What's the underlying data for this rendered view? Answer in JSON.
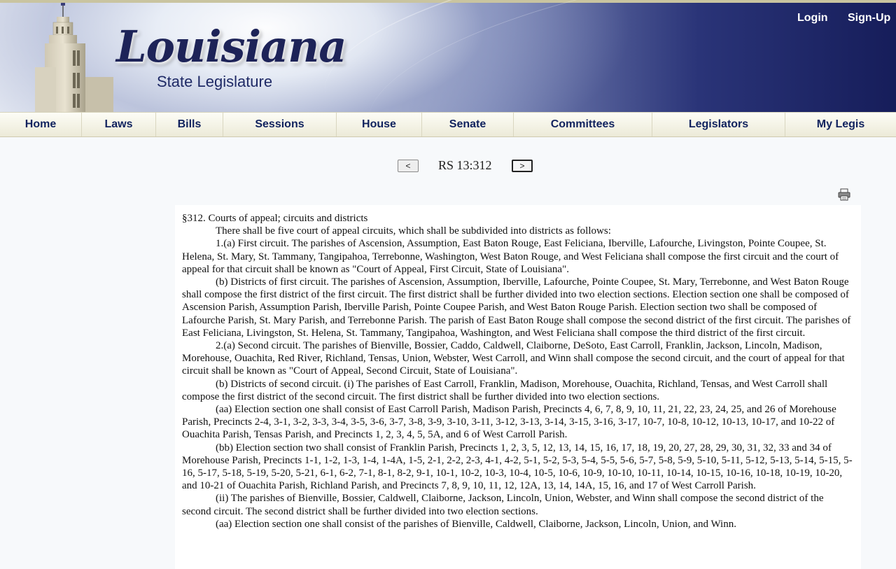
{
  "header": {
    "logo_title": "Louisiana",
    "logo_subtitle": "State Legislature",
    "login_label": "Login",
    "signup_label": "Sign-Up"
  },
  "nav": {
    "items": [
      {
        "label": "Home"
      },
      {
        "label": "Laws"
      },
      {
        "label": "Bills"
      },
      {
        "label": "Sessions"
      },
      {
        "label": "House"
      },
      {
        "label": "Senate"
      },
      {
        "label": "Committees"
      },
      {
        "label": "Legislators"
      },
      {
        "label": "My Legis"
      }
    ]
  },
  "pager": {
    "prev_label": "<",
    "next_label": ">",
    "title": "RS 13:312"
  },
  "document": {
    "heading": "§312. Courts of appeal; circuits and districts",
    "paragraphs": [
      "There shall be five court of appeal circuits, which shall be subdivided into districts as follows:",
      "1.(a) First circuit. The parishes of Ascension, Assumption, East Baton Rouge, East Feliciana, Iberville, Lafourche, Livingston, Pointe Coupee, St. Helena, St. Mary, St. Tammany, Tangipahoa, Terrebonne, Washington, West Baton Rouge, and West Feliciana shall compose the first circuit and the court of appeal for that circuit shall be known as \"Court of Appeal, First Circuit, State of Louisiana\".",
      "(b) Districts of first circuit. The parishes of Ascension, Assumption, Iberville, Lafourche, Pointe Coupee, St. Mary, Terrebonne, and West Baton Rouge shall compose the first district of the first circuit. The first district shall be further divided into two election sections. Election section one shall be composed of Ascension Parish, Assumption Parish, Iberville Parish, Pointe Coupee Parish, and West Baton Rouge Parish. Election section two shall be composed of Lafourche Parish, St. Mary Parish, and Terrebonne Parish. The parish of East Baton Rouge shall compose the second district of the first circuit. The parishes of East Feliciana, Livingston, St. Helena, St. Tammany, Tangipahoa, Washington, and West Feliciana shall compose the third district of the first circuit.",
      "2.(a) Second circuit. The parishes of Bienville, Bossier, Caddo, Caldwell, Claiborne, DeSoto, East Carroll, Franklin, Jackson, Lincoln, Madison, Morehouse, Ouachita, Red River, Richland, Tensas, Union, Webster, West Carroll, and Winn shall compose the second circuit, and the court of appeal for that circuit shall be known as \"Court of Appeal, Second Circuit, State of Louisiana\".",
      "(b) Districts of second circuit. (i) The parishes of East Carroll, Franklin, Madison, Morehouse, Ouachita, Richland, Tensas, and West Carroll shall compose the first district of the second circuit. The first district shall be further divided into two election sections.",
      "(aa) Election section one shall consist of East Carroll Parish, Madison Parish, Precincts 4, 6, 7, 8, 9, 10, 11, 21, 22, 23, 24, 25, and 26 of Morehouse Parish, Precincts 2-4, 3-1, 3-2, 3-3, 3-4, 3-5, 3-6, 3-7, 3-8, 3-9, 3-10, 3-11, 3-12, 3-13, 3-14, 3-15, 3-16, 3-17, 10-7, 10-8, 10-12, 10-13, 10-17, and 10-22 of Ouachita Parish, Tensas Parish, and Precincts 1, 2, 3, 4, 5, 5A, and 6 of West Carroll Parish.",
      "(bb) Election section two shall consist of Franklin Parish, Precincts 1, 2, 3, 5, 12, 13, 14, 15, 16, 17, 18, 19, 20, 27, 28, 29, 30, 31, 32, 33 and 34 of Morehouse Parish, Precincts 1-1, 1-2, 1-3, 1-4, 1-4A, 1-5, 2-1, 2-2, 2-3, 4-1, 4-2, 5-1, 5-2, 5-3, 5-4, 5-5, 5-6, 5-7, 5-8, 5-9, 5-10, 5-11, 5-12, 5-13, 5-14, 5-15, 5-16, 5-17, 5-18, 5-19, 5-20, 5-21, 6-1, 6-2, 7-1, 8-1, 8-2, 9-1, 10-1, 10-2, 10-3, 10-4, 10-5, 10-6, 10-9, 10-10, 10-11, 10-14, 10-15, 10-16, 10-18, 10-19, 10-20, and 10-21 of Ouachita Parish, Richland Parish, and Precincts 7, 8, 9, 10, 11, 12, 12A, 13, 14, 14A, 15, 16, and 17 of West Carroll Parish.",
      "(ii) The parishes of Bienville, Bossier, Caldwell, Claiborne, Jackson, Lincoln, Union, Webster, and Winn shall compose the second district of the second circuit. The second district shall be further divided into two election sections.",
      "(aa) Election section one shall consist of the parishes of Bienville, Caldwell, Claiborne, Jackson, Lincoln, Union, and Winn."
    ]
  }
}
